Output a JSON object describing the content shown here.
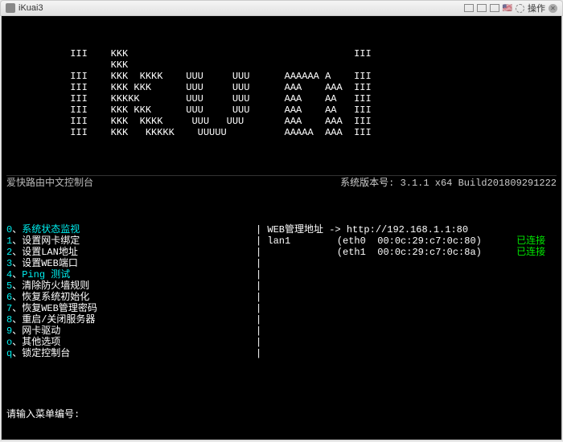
{
  "window": {
    "title": "iKuai3",
    "action_label": "操作"
  },
  "ascii_art": "           III    KKK                                       III\n                  KKK\n           III    KKK  KKKK    UUU     UUU      AAAAAA A    III\n           III    KKK KKK      UUU     UUU      AAA    AAA  III\n           III    KKKKK        UUU     UUU      AAA    AA   III\n           III    KKK KKK      UUU     UUU      AAA    AA   III\n           III    KKK  KKKK     UUU   UUU       AAA    AAA  III\n           III    KKK   KKKKK    UUUUU          AAAAA  AAA  III",
  "header": {
    "left": "爱快路由中文控制台",
    "right_label": "系统版本号: ",
    "version": "3.1.1 x64 Build201809291222"
  },
  "menu": [
    {
      "key": "0",
      "sep": "、",
      "label": "系统状态监视",
      "cyan": true
    },
    {
      "key": "1",
      "sep": "、",
      "label": "设置网卡绑定",
      "cyan": false
    },
    {
      "key": "2",
      "sep": "、",
      "label": "设置LAN地址",
      "cyan": false
    },
    {
      "key": "3",
      "sep": "、",
      "label": "设置WEB端口",
      "cyan": false
    },
    {
      "key": "4",
      "sep": "、",
      "label": "Ping 测试",
      "cyan": true
    },
    {
      "key": "5",
      "sep": "、",
      "label": "清除防火墙规则",
      "cyan": false
    },
    {
      "key": "6",
      "sep": "、",
      "label": "恢复系统初始化",
      "cyan": false
    },
    {
      "key": "7",
      "sep": "、",
      "label": "恢复WEB管理密码",
      "cyan": false
    },
    {
      "key": "8",
      "sep": "、",
      "label": "重启/关闭服务器",
      "cyan": false
    },
    {
      "key": "9",
      "sep": "、",
      "label": "网卡驱动",
      "cyan": false
    },
    {
      "key": "o",
      "sep": "、",
      "label": "其他选项",
      "cyan": false
    },
    {
      "key": "q",
      "sep": "、",
      "label": "锁定控制台",
      "cyan": false
    }
  ],
  "status": {
    "web_label": "WEB管理地址 -> ",
    "web_url": "http://192.168.1.1:80",
    "lan_name": "lan1",
    "ifaces": [
      {
        "name": "eth0",
        "mac": "00:0c:29:c7:0c:80",
        "state": "已连接"
      },
      {
        "name": "eth1",
        "mac": "00:0c:29:c7:0c:8a",
        "state": "已连接"
      }
    ]
  },
  "prompt": "请输入菜单编号:",
  "colors": {
    "cyan": "#00f0f0",
    "green": "#00e800",
    "bg": "#000000",
    "fg": "#ffffff"
  }
}
